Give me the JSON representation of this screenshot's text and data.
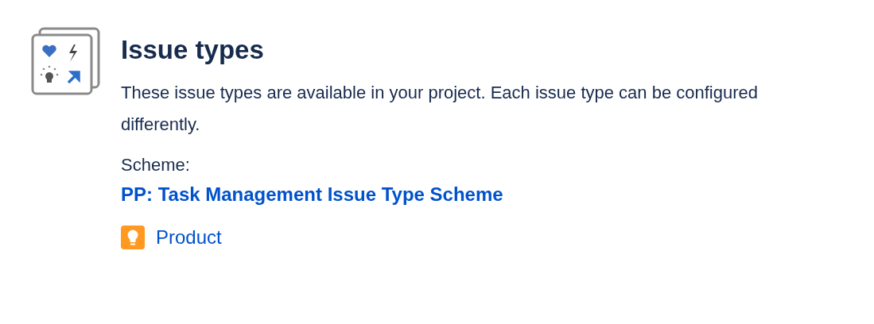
{
  "title": "Issue types",
  "description": "These issue types are available in your project. Each issue type can be configured differently.",
  "scheme_label": "Scheme:",
  "scheme_link": "PP: Task Management Issue Type Scheme",
  "issue_types": [
    {
      "label": "Product",
      "color": "#ff991f"
    }
  ]
}
